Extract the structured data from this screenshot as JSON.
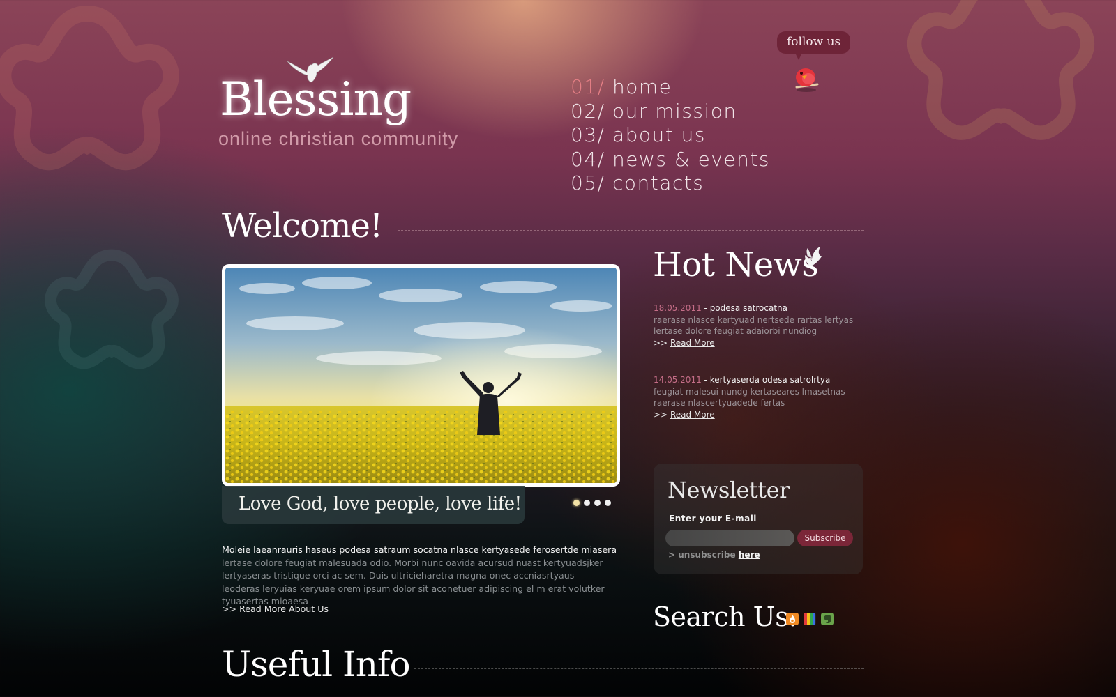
{
  "brand": {
    "title": "Blessing",
    "tagline": "online christian community",
    "logo_icon": "dove-icon"
  },
  "nav": {
    "items": [
      {
        "num": "01/",
        "label": "home",
        "active": true
      },
      {
        "num": "02/",
        "label": "our mission",
        "active": false
      },
      {
        "num": "03/",
        "label": "about us",
        "active": false
      },
      {
        "num": "04/",
        "label": "news & events",
        "active": false
      },
      {
        "num": "05/",
        "label": "contacts",
        "active": false
      }
    ]
  },
  "follow": {
    "label": "follow us",
    "icon": "twitter-bird-icon"
  },
  "welcome": {
    "title": "Welcome!",
    "slider": {
      "caption": "Love God, love people, love life!",
      "slide_count": 4,
      "active_slide": 1
    },
    "intro_lead": "Moleie laeanrauris haseus podesa satraum socatna nlasce kertyasede ferosertde miasera",
    "intro_body": "lertase dolore feugiat malesuada odio. Morbi nunc oavida acursud nuast kertyuadsjker lertyaseras tristique orci ac sem. Duis ultricieharetra magna onec accniasrtyaus leoderas leryuias keryuae orem ipsum dolor sit aconetuer adipiscing el m erat volutker tyuasertas mioaesa",
    "read_more_prefix": ">>",
    "read_more_label": "Read More About Us"
  },
  "hot_news": {
    "title": "Hot News",
    "icon": "dove-icon",
    "items": [
      {
        "date": "18.05.2011",
        "separator": " -  ",
        "title": "podesa satrocatna",
        "body": "raerase nlasce kertyuad nertsede rartas lertyas lertase dolore feugiat adaiorbi nundiog",
        "link_prefix": ">> ",
        "link_label": "Read More"
      },
      {
        "date": "14.05.2011",
        "separator": " -  ",
        "title": "kertyaserda odesa satrolrtya",
        "body": "feugiat malesui nundg kertaseares lmasetnas raerase nlascertyuadede fertas",
        "link_prefix": ">> ",
        "link_label": "Read More"
      }
    ]
  },
  "newsletter": {
    "title": "Newsletter",
    "email_label": "Enter your E-mail",
    "email_value": "",
    "email_placeholder": "",
    "subscribe_label": "Subscribe",
    "unsubscribe_prefix": "> unsubscribe ",
    "unsubscribe_link": "here"
  },
  "search_us": {
    "title": "Search Us:",
    "icons": [
      "rss-flame-icon",
      "rainbow-stripes-icon",
      "evernote-icon"
    ],
    "colors": [
      "#f08a24",
      "#e23b9a",
      "#6aa34a"
    ]
  },
  "useful_info": {
    "title": "Useful Info"
  },
  "colors": {
    "accent_pink": "#e57f85",
    "date_pink": "#c56e88",
    "subscribe_button": "#7b2638",
    "follow_bubble": "#6e2438"
  }
}
